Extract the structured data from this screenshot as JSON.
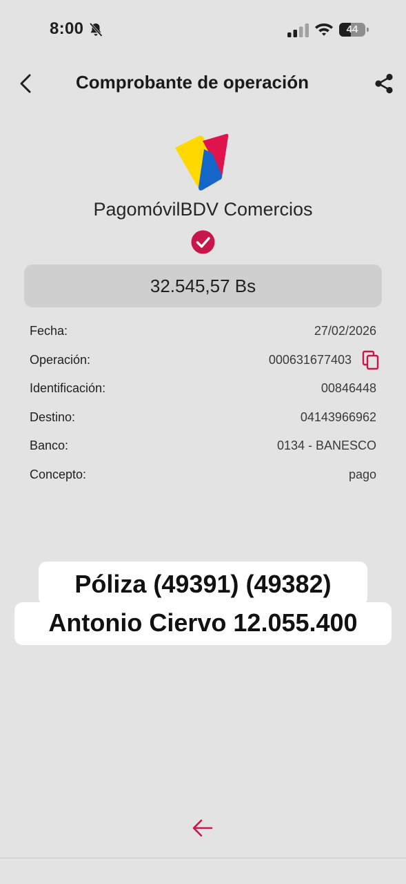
{
  "status_bar": {
    "time": "8:00",
    "battery": "44",
    "battery_level": 0.44
  },
  "header": {
    "title": "Comprobante de operación",
    "back_icon": "chevron-left-icon",
    "share_icon": "share-icon"
  },
  "brand": {
    "name": "PagomóvilBDV Comercios",
    "colors": {
      "yellow": "#ffd800",
      "red": "#e0144c",
      "blue": "#1467c8"
    }
  },
  "amount": "32.545,57 Bs",
  "details": [
    {
      "label": "Fecha:",
      "value": "27/02/2026"
    },
    {
      "label": "Operación:",
      "value": "000631677403"
    },
    {
      "label": "Identificación:",
      "value": "00846448"
    },
    {
      "label": "Destino:",
      "value": "04143966962"
    },
    {
      "label": "Banco:",
      "value": "0134 - BANESCO"
    },
    {
      "label": "Concepto:",
      "value": "pago"
    }
  ],
  "overlay_note": {
    "line1": "Póliza (49391) (49382)",
    "line2": "Antonio Ciervo 12.055.400"
  },
  "colors": {
    "accent": "#c8154a",
    "background": "#e3e3e3",
    "amount_box": "#cfcfcf"
  }
}
